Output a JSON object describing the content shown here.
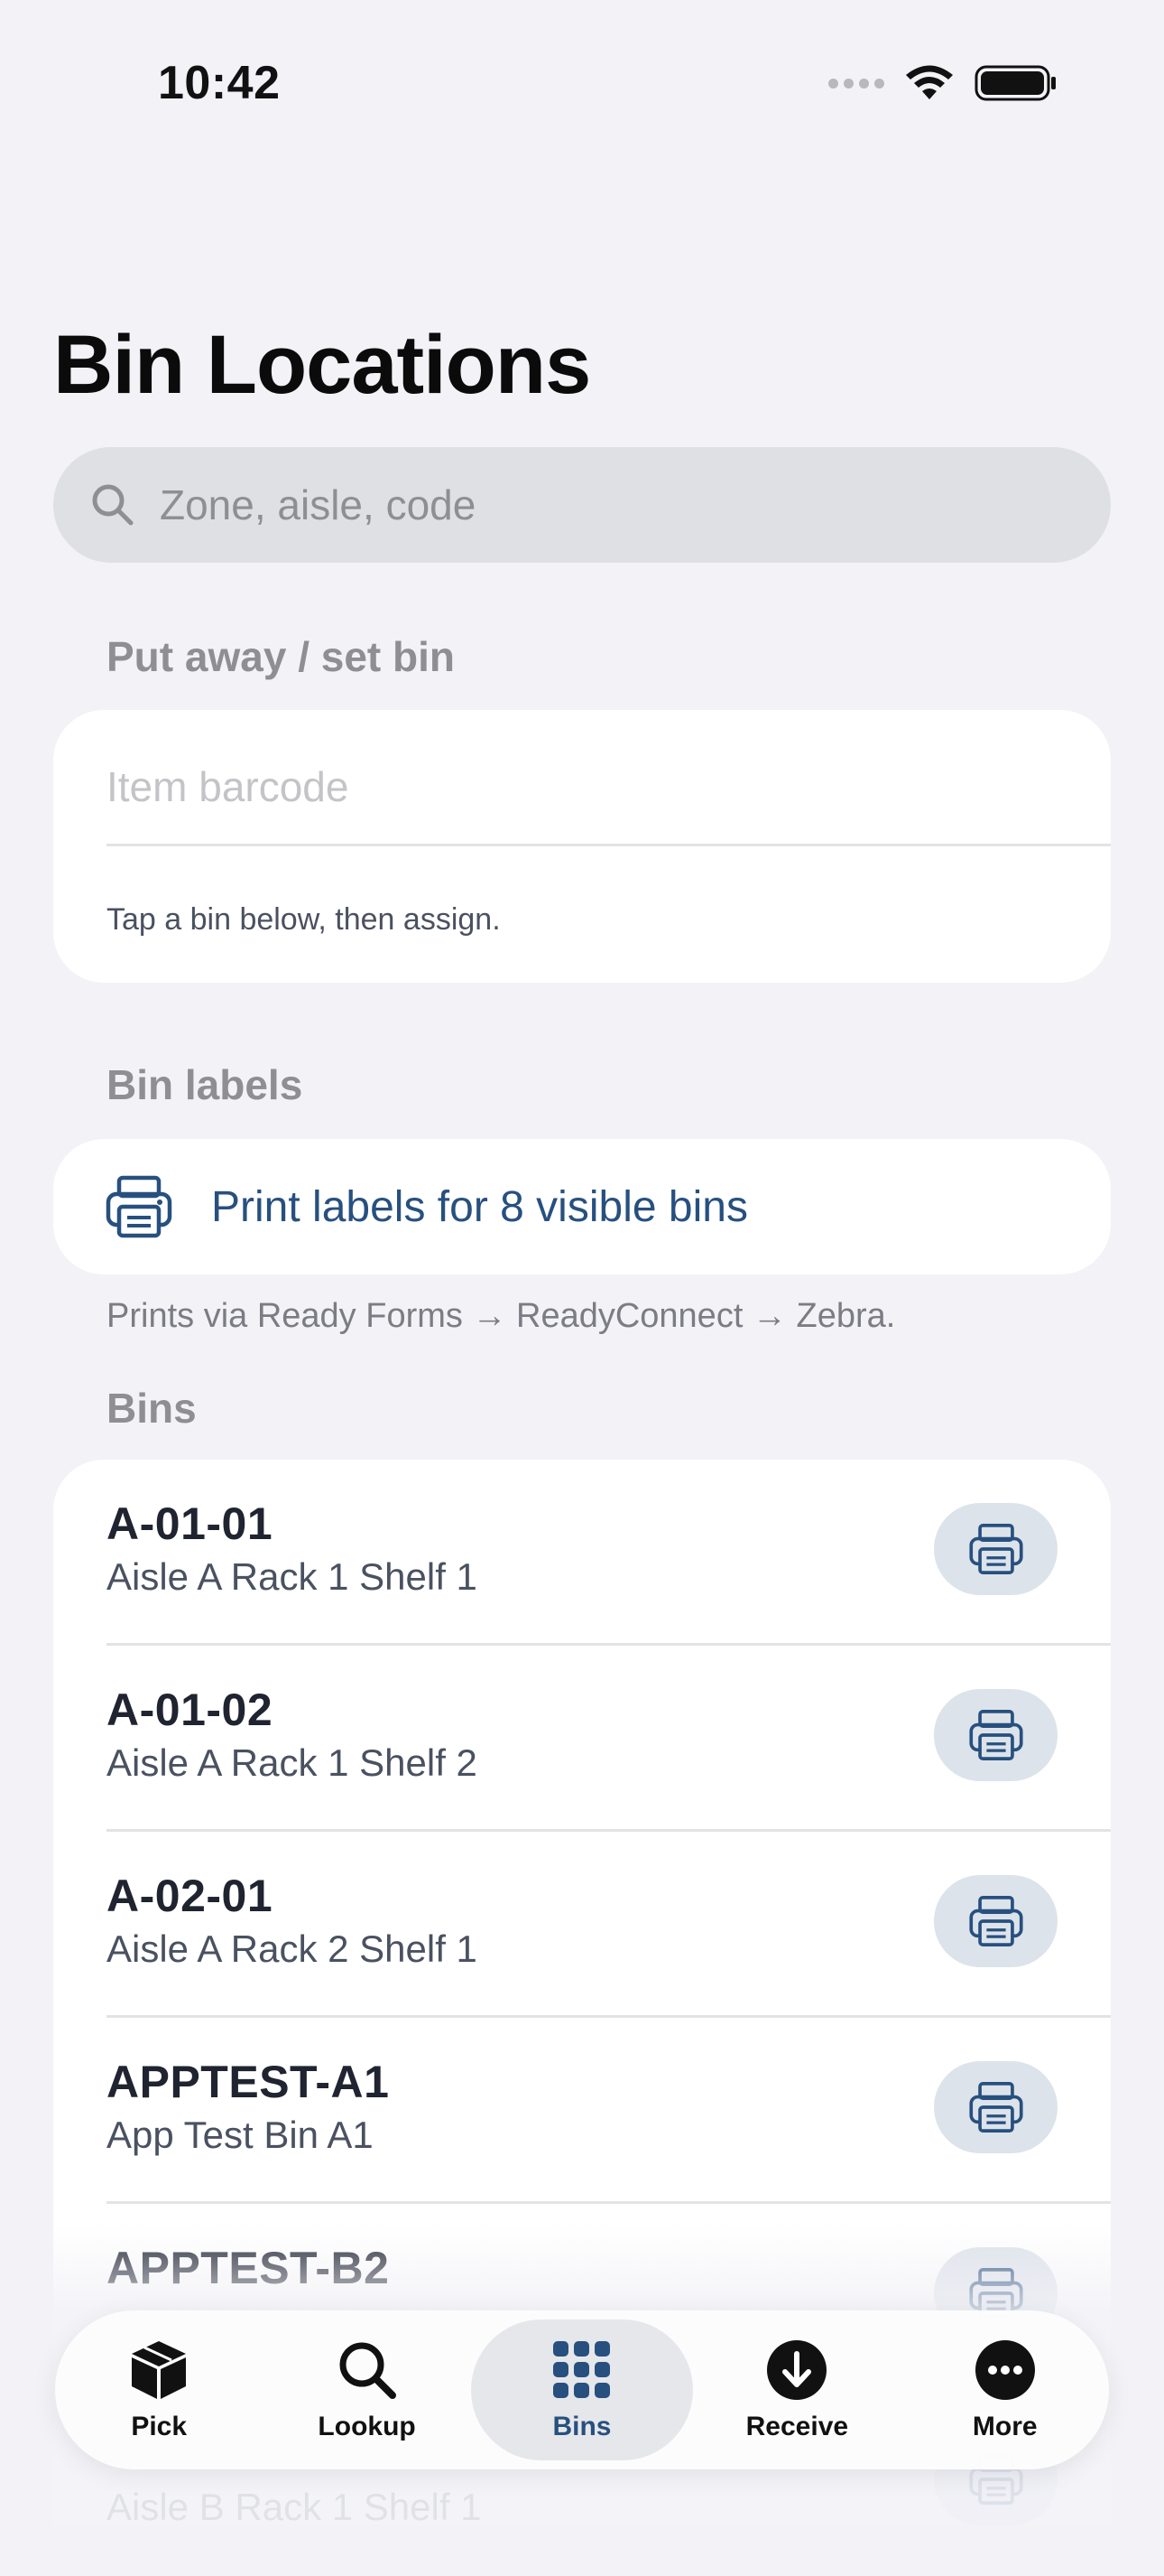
{
  "status_bar": {
    "time": "10:42"
  },
  "title": "Bin Locations",
  "search": {
    "placeholder": "Zone, aisle, code",
    "value": ""
  },
  "put_away": {
    "section_label": "Put away / set bin",
    "barcode_placeholder": "Item barcode",
    "barcode_value": "",
    "helper": "Tap a bin below, then assign."
  },
  "labels": {
    "section_label": "Bin labels",
    "print_all_label": "Print labels for 8 visible bins",
    "footnote": "Prints via Ready Forms → ReadyConnect → Zebra."
  },
  "bins": {
    "section_label": "Bins",
    "items": [
      {
        "code": "A-01-01",
        "description": "Aisle A Rack 1 Shelf 1"
      },
      {
        "code": "A-01-02",
        "description": "Aisle A Rack 1 Shelf 2"
      },
      {
        "code": "A-02-01",
        "description": "Aisle A Rack 2 Shelf 1"
      },
      {
        "code": "APPTEST-A1",
        "description": "App Test Bin A1"
      },
      {
        "code": "APPTEST-B2",
        "description": ""
      },
      {
        "code": "",
        "description": "Aisle B Rack 1 Shelf 1"
      }
    ]
  },
  "tab_bar": {
    "tabs": [
      {
        "label": "Pick",
        "icon": "cube-icon"
      },
      {
        "label": "Lookup",
        "icon": "magnifier-icon"
      },
      {
        "label": "Bins",
        "icon": "grid-icon",
        "active": true
      },
      {
        "label": "Receive",
        "icon": "arrow-down-circle-icon"
      },
      {
        "label": "More",
        "icon": "ellipsis-circle-icon"
      }
    ]
  },
  "colors": {
    "accent": "#27507f",
    "background": "#f2f2f7",
    "pill": "#dde3ea"
  }
}
